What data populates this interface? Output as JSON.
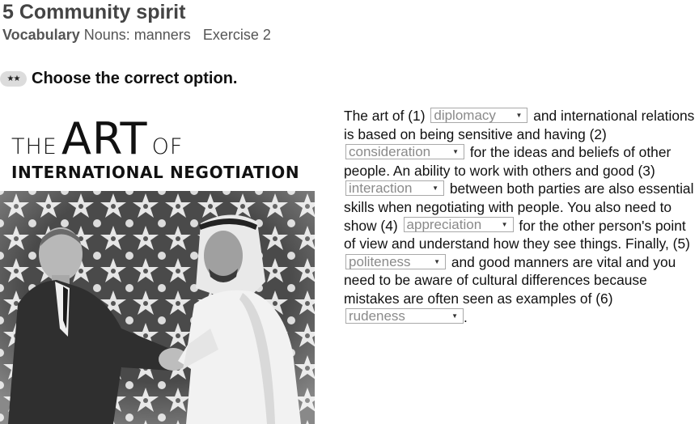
{
  "header": {
    "title": "5 Community spirit",
    "section": "Vocabulary",
    "topic": "Nouns: manners",
    "exercise": "Exercise 2"
  },
  "instruction": {
    "level": "★★",
    "text": "Choose the correct option."
  },
  "illustration": {
    "title_small_1": "THE",
    "title_big": "ART",
    "title_small_2": "OF",
    "subtitle": "INTERNATIONAL NEGOTIATION"
  },
  "passage": {
    "t0": "The art of (1)",
    "t1": "and international relations is based on being sensitive and having (2)",
    "t2": "for the ideas and beliefs of other people. An ability to work with others and good (3)",
    "t3": "between both parties are also essential skills when negotiating with people. You also need to show (4)",
    "t4": "for the other person's point of view and understand how they see things. Finally, (5)",
    "t5": "and good manners are vital and you need to be aware of cultural differences because mistakes are often seen as examples of (6)",
    "t6": ".",
    "gaps": [
      "diplomacy",
      "consideration",
      "interaction",
      "appreciation",
      "politeness",
      "rudeness"
    ]
  }
}
